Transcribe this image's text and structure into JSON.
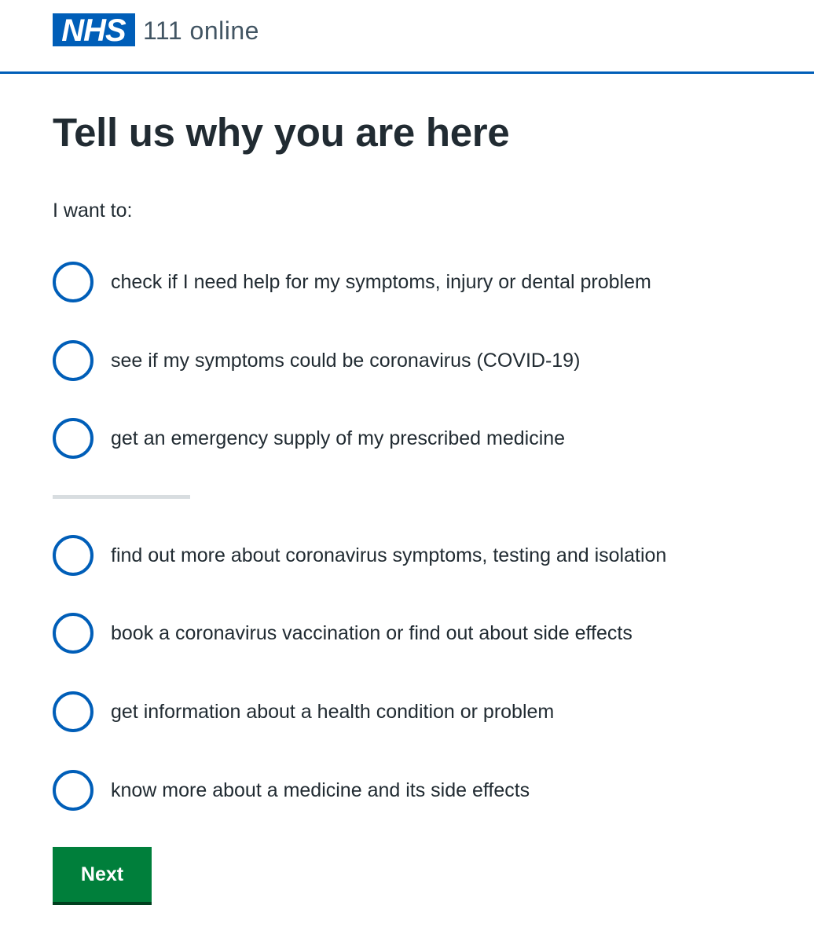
{
  "header": {
    "logo_text": "NHS",
    "service_name": "111 online",
    "brand_color": "#005eb8"
  },
  "main": {
    "title": "Tell us why you are here",
    "legend": "I want to:",
    "options_group_1": [
      {
        "label": "check if I need help for my symptoms, injury or dental problem",
        "selected": false
      },
      {
        "label": "see if my symptoms could be coronavirus (COVID-19)",
        "selected": false
      },
      {
        "label": "get an emergency supply of my prescribed medicine",
        "selected": false
      }
    ],
    "options_group_2": [
      {
        "label": "find out more about coronavirus symptoms, testing and isolation",
        "selected": false
      },
      {
        "label": "book a coronavirus vaccination or find out about side effects",
        "selected": false
      },
      {
        "label": "get information about a health condition or problem",
        "selected": false
      },
      {
        "label": "know more about a medicine and its side effects",
        "selected": false
      }
    ],
    "next_button": "Next",
    "button_color": "#007f3b"
  }
}
